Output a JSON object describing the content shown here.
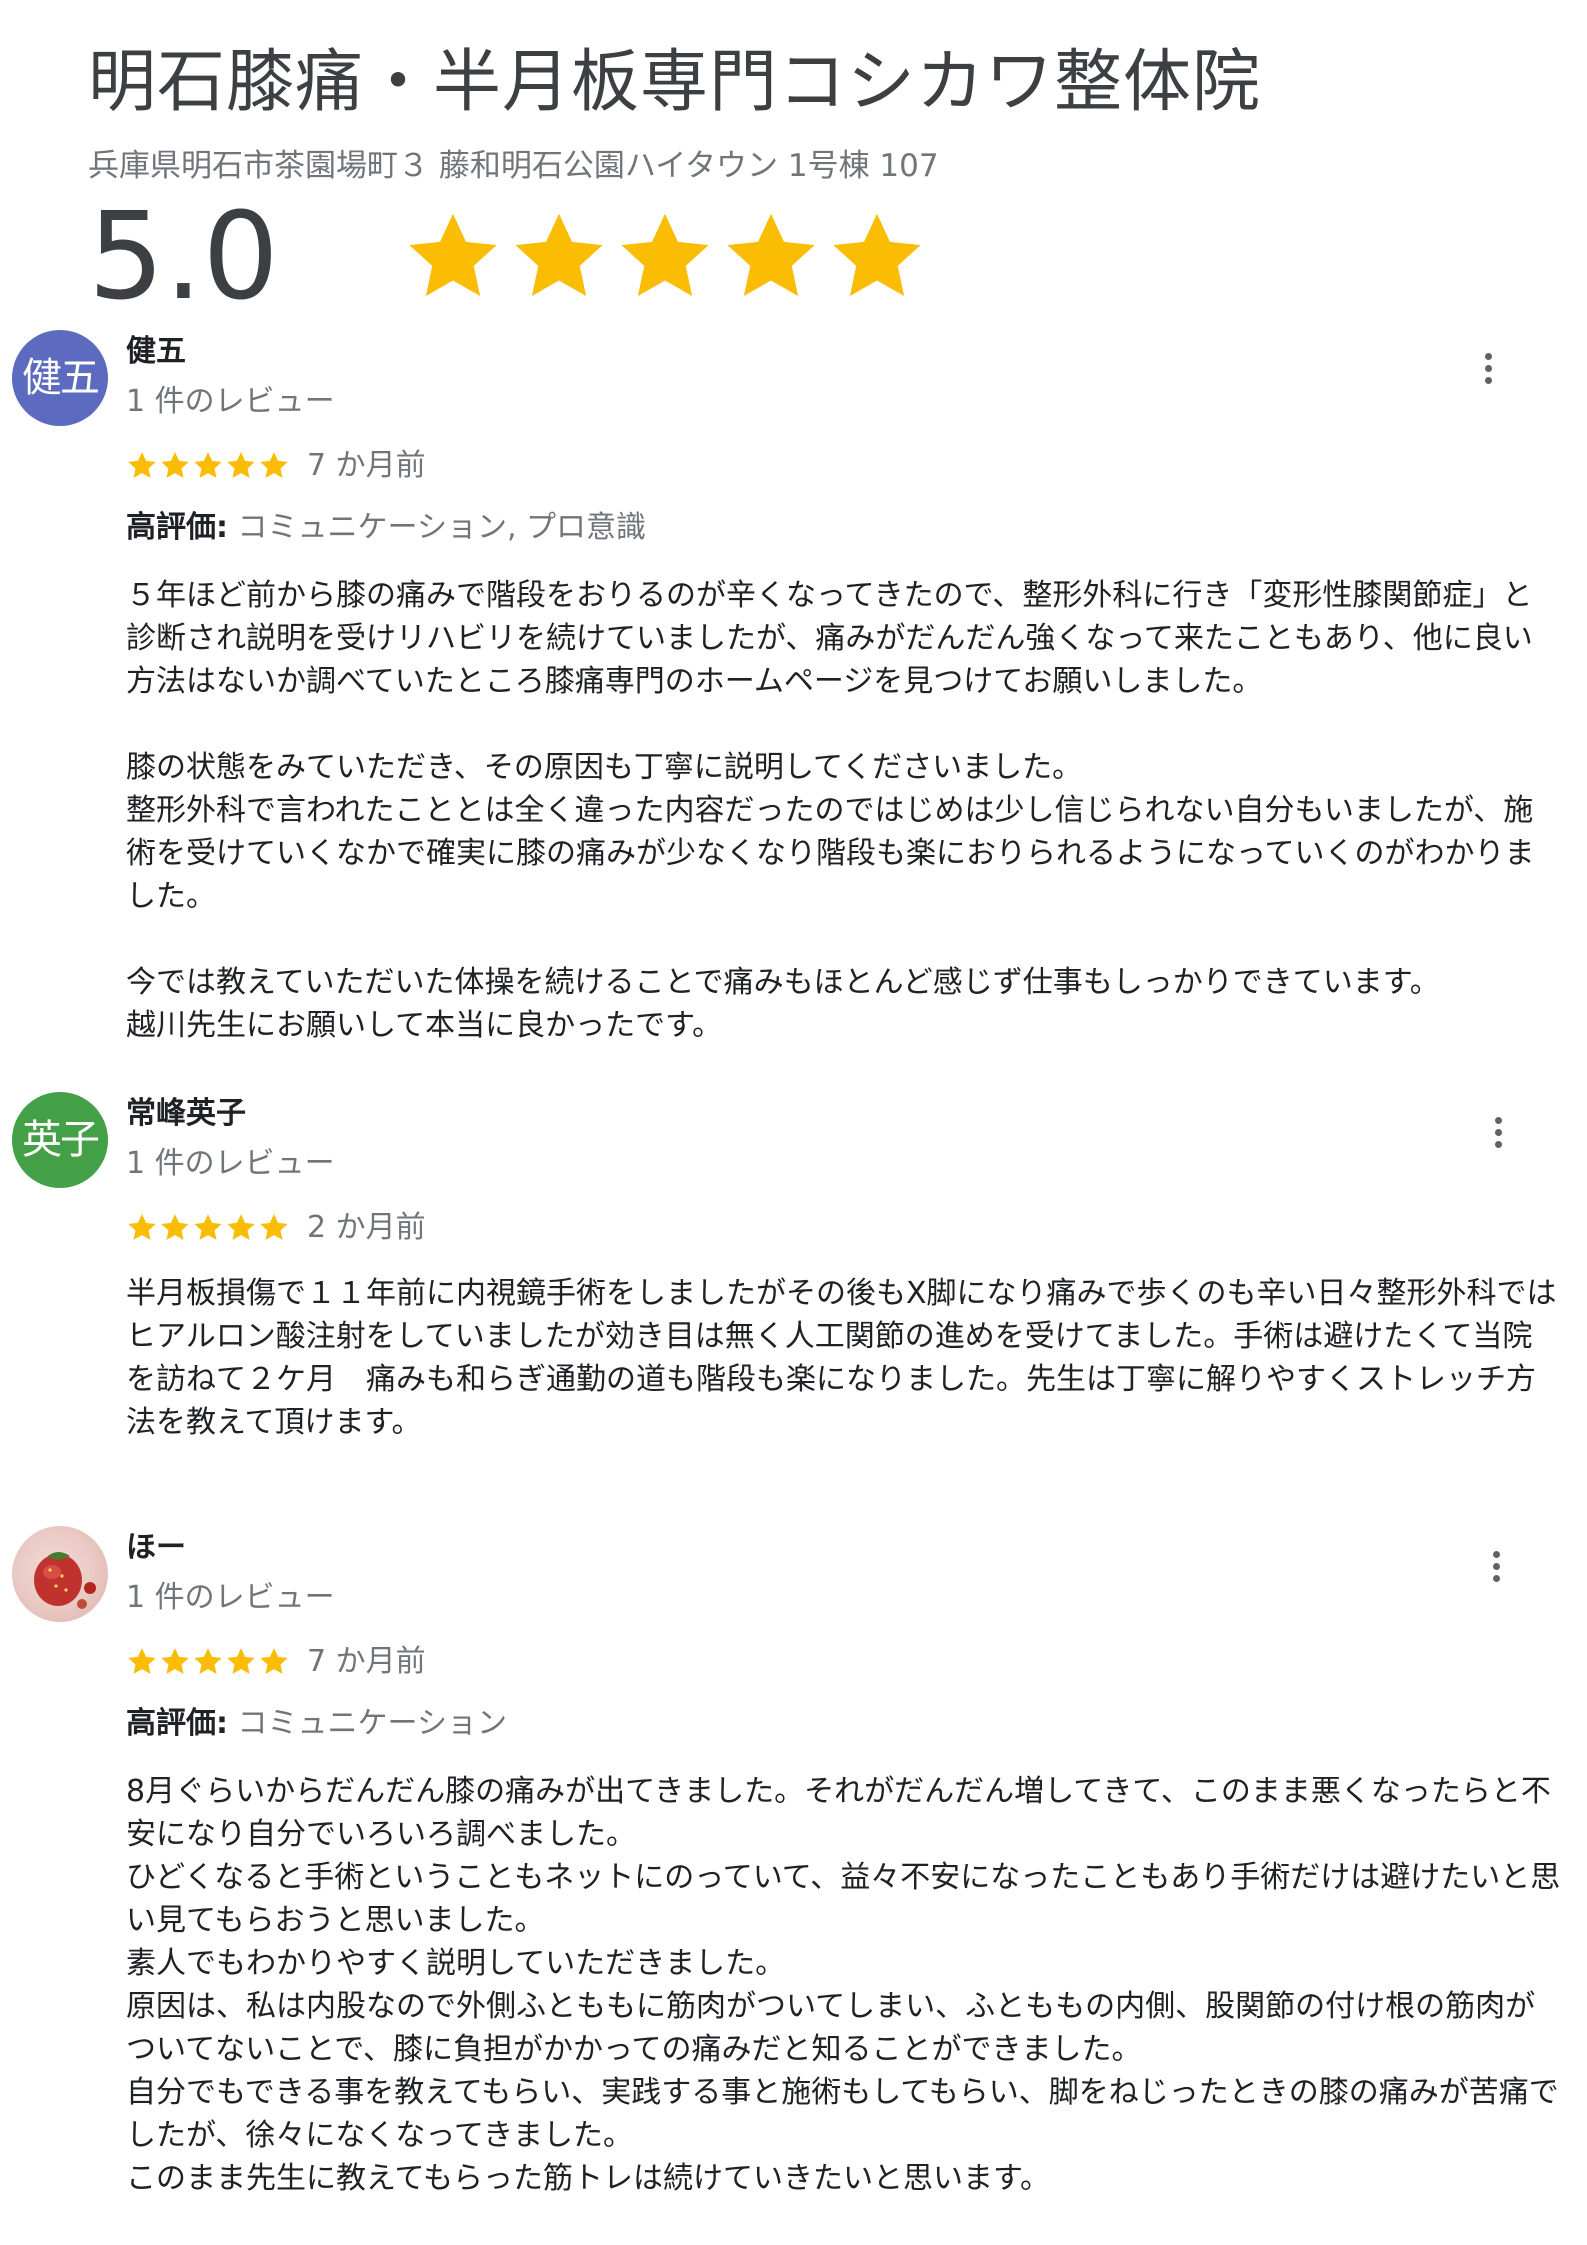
{
  "business": {
    "name": "明石膝痛・半月板専門コシカワ整体院",
    "address": "兵庫県明石市茶園場町３ 藤和明石公園ハイタウン 1号棟 107",
    "rating": "5.0"
  },
  "colors": {
    "star": "#fbbc04",
    "avatar_1": "#5c6bc0",
    "avatar_2": "#43a047"
  },
  "icons": {
    "review_menu": "more-vert-icon",
    "rating_star": "star-icon"
  },
  "reviews": [
    {
      "avatar_text": "健五",
      "name": "健五",
      "count": "1 件のレビュー",
      "stars": 5,
      "date": "7 か月前",
      "highlights_label": "高評価:",
      "highlights": "コミュニケーション, プロ意識",
      "body": "５年ほど前から膝の痛みで階段をおりるのが辛くなってきたので、整形外科に行き「変形性膝関節症」と診断され説明を受けリハビリを続けていましたが、痛みがだんだん強くなって来たこともあり、他に良い方法はないか調べていたところ膝痛専門のホームページを見つけてお願いしました。\n\n膝の状態をみていただき、その原因も丁寧に説明してくださいました。\n整形外科で言われたこととは全く違った内容だったのではじめは少し信じられない自分もいましたが、施術を受けていくなかで確実に膝の痛みが少なくなり階段も楽におりられるようになっていくのがわかりました。\n\n今では教えていただいた体操を続けることで痛みもほとんど感じず仕事もしっかりできています。\n越川先生にお願いして本当に良かったです。"
    },
    {
      "avatar_text": "英子",
      "name": "常峰英子",
      "count": "1 件のレビュー",
      "stars": 5,
      "date": "2 か月前",
      "highlights_label": "",
      "highlights": "",
      "body": "半月板損傷で１１年前に内視鏡手術をしましたがその後もX脚になり痛みで歩くのも辛い日々整形外科ではヒアルロン酸注射をしていましたが効き目は無く人工関節の進めを受けてました。手術は避けたくて当院を訪ねて２ケ月　痛みも和らぎ通勤の道も階段も楽になりました。先生は丁寧に解りやすくストレッチ方法を教えて頂けます。"
    },
    {
      "avatar_text": "",
      "name": "ほー",
      "count": "1 件のレビュー",
      "stars": 5,
      "date": "7 か月前",
      "highlights_label": "高評価:",
      "highlights": "コミュニケーション",
      "body": "8月ぐらいからだんだん膝の痛みが出てきました。それがだんだん増してきて、このまま悪くなったらと不安になり自分でいろいろ調べました。\nひどくなると手術ということもネットにのっていて、益々不安になったこともあり手術だけは避けたいと思い見てもらおうと思いました。\n素人でもわかりやすく説明していただきました。\n原因は、私は内股なので外側ふとももに筋肉がついてしまい、ふとももの内側、股関節の付け根の筋肉がついてないことで、膝に負担がかかっての痛みだと知ることができました。\n自分でもできる事を教えてもらい、実践する事と施術もしてもらい、脚をねじったときの膝の痛みが苦痛でしたが、徐々になくなってきました。\nこのまま先生に教えてもらった筋トレは続けていきたいと思います。"
    }
  ]
}
